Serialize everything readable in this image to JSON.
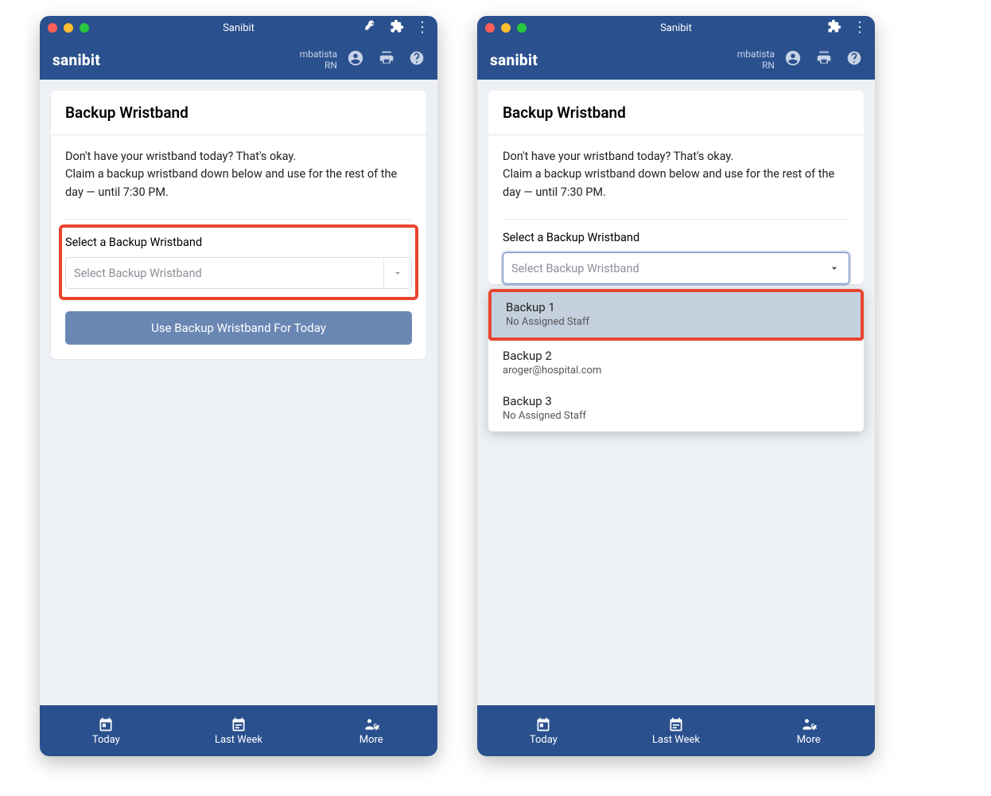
{
  "window": {
    "title": "Sanibit"
  },
  "appbar": {
    "brand": "sanibit",
    "user_name": "mbatista",
    "user_role": "RN"
  },
  "card": {
    "title": "Backup Wristband",
    "body_line1": "Don't have your wristband today? That's okay.",
    "body_line2": "Claim a backup wristband down below and use for the rest of the day — until 7:30 PM.",
    "select_label": "Select a Backup Wristband",
    "select_placeholder": "Select Backup Wristband",
    "submit_label": "Use Backup Wristband For Today"
  },
  "dropdown": {
    "options": [
      {
        "title": "Backup 1",
        "sub": "No Assigned Staff"
      },
      {
        "title": "Backup 2",
        "sub": "aroger@hospital.com"
      },
      {
        "title": "Backup 3",
        "sub": "No Assigned Staff"
      }
    ]
  },
  "bottomnav": {
    "today": "Today",
    "lastweek": "Last Week",
    "more": "More"
  }
}
